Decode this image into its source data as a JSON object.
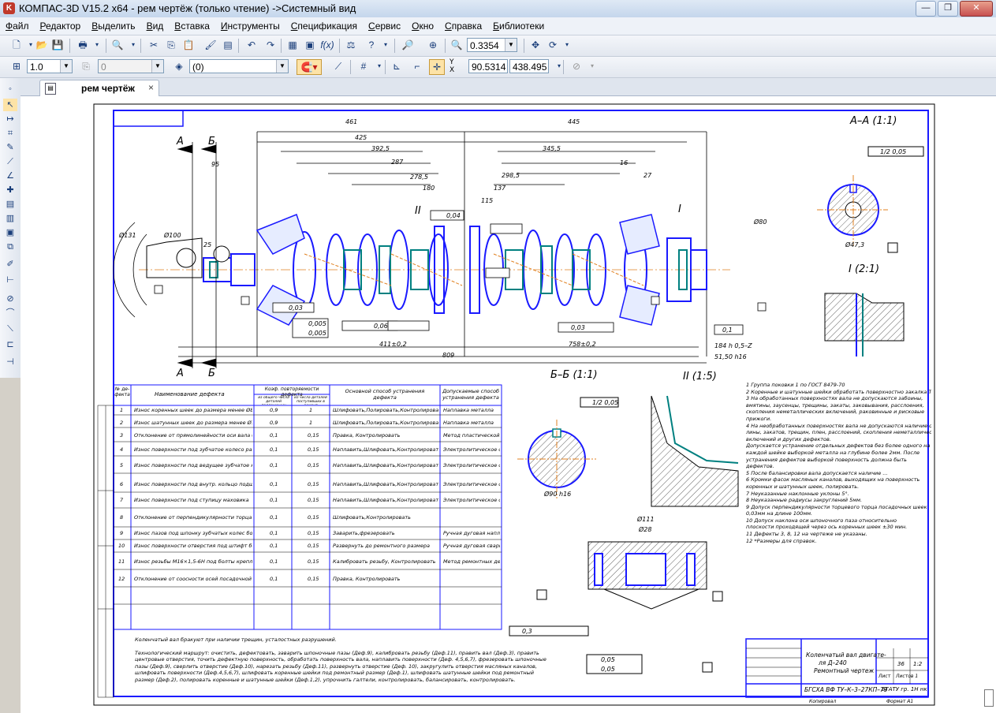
{
  "window": {
    "title": "КОМПАС-3D V15.2  x64 - рем чертёж (только чтение) ->Системный вид",
    "controls": [
      "minimize",
      "restore",
      "close"
    ]
  },
  "menu": {
    "items": [
      "Файл",
      "Редактор",
      "Выделить",
      "Вид",
      "Вставка",
      "Инструменты",
      "Спецификация",
      "Сервис",
      "Окно",
      "Справка",
      "Библиотеки"
    ]
  },
  "toolbar": {
    "zoom_value": "0.3354",
    "line_scale": "1.0",
    "step": "0",
    "layer": "(0)",
    "coord_x": "90.5314",
    "coord_y": "438.495",
    "coord_label": "Y",
    "coord_label2": "X"
  },
  "document_tab": {
    "label": "рем чертёж",
    "close": "×"
  },
  "drawing": {
    "section_aa": "А–А (1:1)",
    "section_bb": "Б–Б (1:1)",
    "view_1": "I (2:1)",
    "view_2": "II (1:5)",
    "label_a1": "А",
    "label_b1": "Б",
    "label_i": "I",
    "label_ii": "II",
    "dims": {
      "d1": "461",
      "d2": "445",
      "d3": "425",
      "d4": "392,5",
      "d5": "345,5",
      "d6": "287",
      "d7": "278,5",
      "d8": "298,5",
      "d9": "180",
      "d10": "137",
      "d11": "115",
      "d12": "95",
      "d13": "25",
      "d14": "27",
      "d15": "16",
      "d16": "411±0,2",
      "d17": "758±0,2",
      "d18": "809",
      "d19": "184 h 0,5–Z",
      "d20": "51,50 h16",
      "d21": "Ø80",
      "d22": "Ø131",
      "d23": "Ø100",
      "d24": "Ø47,3",
      "d25": "Ø90",
      "d26": "Ø111",
      "d27": "Ø28",
      "d28": "Ø90 h16"
    },
    "tolerances": {
      "t1": "0,03",
      "t2": "0,005",
      "t3": "0,06",
      "t4": "0,03",
      "t5": "0,1",
      "t6": "0,04",
      "t7": "1/2 0,05",
      "t8": "0,05",
      "t9": "0,05",
      "t10": "0,3"
    },
    "table": {
      "headers": [
        "№ де-фекта",
        "Наименование дефекта",
        "Коэф. повторяемости дефекта",
        "Основной способ устранения дефекта",
        "Допускаемые способ устранения дефекта"
      ],
      "subheaders": [
        "из общего числа деталей подлежащих ремонту",
        "из числа деталей поступивших в ремонт"
      ],
      "rows": [
        [
          "1",
          "Износ коренных шеек до размера менее Ø84,75",
          "0,9",
          "1",
          "Шлифовать,Полировать,Контролировать",
          "Наплавка металла"
        ],
        [
          "2",
          "Износ шатунных шеек до размера менее Ø72,60",
          "0,9",
          "1",
          "Шлифовать,Полировать,Контролировать",
          "Наплавка металла"
        ],
        [
          "3",
          "Отклонение от прямолинейности оси вала более 0,03мм",
          "0,1",
          "0,15",
          "Правка, Контролировать",
          "Метод пластической деформации"
        ],
        [
          "4",
          "Износ поверхности под зубчатое колесо распределительного размера Ø56,03мм",
          "0,1",
          "0,15",
          "Наплавить,Шлифовать,Контролировать",
          "Электролитическое обработка"
        ],
        [
          "5",
          "Износ поверхности под ведущее зубчатое колесо привода масляного насоса менее размера Ø55,98мм",
          "0,1",
          "0,15",
          "Наплавить,Шлифовать,Контролировать",
          "Электролитическое обработка"
        ],
        [
          "6",
          "Износ поверхности под внутр. кольцо подшипника",
          "0,1",
          "0,15",
          "Наплавить,Шлифовать,Контролировать",
          "Электролитическое обработка"
        ],
        [
          "7",
          "Износ поверхности под ступицу маховика",
          "0,1",
          "0,15",
          "Наплавить,Шлифовать,Контролировать",
          "Электролитическое обработка"
        ],
        [
          "8",
          "Отклонение от перпендикулярности торца фланца",
          "0,1",
          "0,15",
          "Шлифовать,Контролировать",
          ""
        ],
        [
          "9",
          "Износ пазов под шпонку зубчатых колес более 6,02мм",
          "0,1",
          "0,15",
          "Заварить,фрезеровать",
          "Ручная дуговая наплавка"
        ],
        [
          "10",
          "Износ поверхности отверстия под штифт более Ø13,04мм",
          "0,1",
          "0,15",
          "Развернуть до ремонтного размера",
          "Ручная дуговая сварка"
        ],
        [
          "11",
          "Износ резьбы М16×1,5-6Н под болты крепления маховика",
          "0,1",
          "0,15",
          "Калибровать резьбу, Контролировать",
          "Метод ремонтных деталей"
        ],
        [
          "12",
          "Отклонение от соосности осей посадочной шейки под маховик",
          "0,1",
          "0,15",
          "Правка, Контролировать",
          ""
        ]
      ]
    },
    "notes": [
      "1 Группа поковки 1 по ГОСТ 8479-70",
      "2 Коренные и шатунные шейки обработать поверхностно закалка ТВЧ 52...62HRC Глубина закаленного слоя не менее 2мм",
      "3 На обработанных поверхностях вала не допускаются забоины,",
      "  вмятины, заусенцы, трещины, закаты, заковывания, расслоения,",
      "  скопления неметаллических включений, раковинные и рисковые",
      "  прижоги.",
      "4 На необработанных поверхностях вала не допускаются наличие оки-",
      "  лины, закатов, трещин, плен, расслоений, скопления неметаллических",
      "  включений и других дефектов.",
      "  Допускается устранение отдельных дефектов без более одного на",
      "  каждой шейке выборкой металла на глубине более 2мм. После",
      "  устранения дефектов выборкой поверхность должна быть",
      "  дефектов.",
      "5 После балансировки вала допускается наличие ...",
      "6 Кромки фасок масляных каналов, выходящих на поверхность",
      "  коренных и шатунных шеек, полировать.",
      "7 Неуказанные наклонные уклоны 5°.",
      "8 Неуказанные радиусы закруглений 5мм.",
      "9 Допуск перпендикулярности торцевого торца посадочных шеек",
      "  0,03мм на длине 100мм.",
      "10 Допуск наклона оси шпоночного паза относительно",
      "   плоскости проходящей через ось коренных шеек ±30 мин.",
      "11 Дефекты 3, 8, 12 на чертеже не указаны.",
      "12 *Размеры для справок."
    ],
    "bottom_notes": [
      "Коленчатый вал бракуют при наличии трещин, усталостных разрушений.",
      "Технологический маршрут: очистить, дефектовать, заварить шпоночные пазы (Деф.9), калибровать резьбу (Деф.11), править вал (Деф.3), править",
      "центровые отверстия, точить дефектную поверхность, обработать поверхность вала, наплавить поверхности (Деф. 4,5,6,7), фрезеровать шпоночные",
      "пазы (Деф.9), сверлить отверстие (Деф.10), нарезать резьбу (Деф.11), развернуть отверстие (Деф. 10), закругулить отверстия масляных каналов,",
      "шлифовать поверхности (Деф.4,5,6,7), шлифовать коренные шейки под ремонтный размер (Деф.1), шлифовать шатунные шейки под ремонтный",
      "размер (Деф.2), полировать коренные и шатунные шейки (Деф.1,2), упрочнить галтели, контролировать, балансировать, контролировать."
    ],
    "stamp": {
      "title_line1": "Коленчатый вал двигате-",
      "title_line2": "ля Д–240",
      "title_line3": "Ремонтный чертеж",
      "mass": "36",
      "scale": "1:2",
      "code": "БГСХА ВФ ТУ–К–3–27КП–79",
      "group": "БГАТУ гр. 1Н нк",
      "sheet": "Лист",
      "sheets": "Листов 1",
      "format": "Формат А1",
      "copied": "Копировал"
    }
  }
}
